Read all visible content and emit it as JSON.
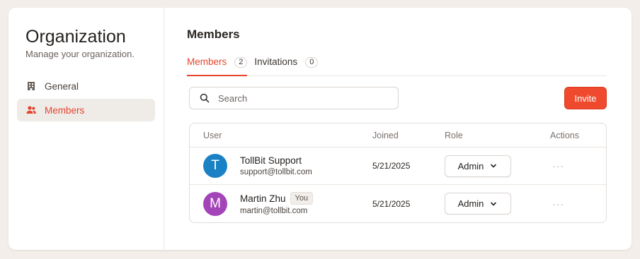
{
  "sidebar": {
    "title": "Organization",
    "subtitle": "Manage your organization.",
    "items": [
      {
        "label": "General",
        "icon": "building-icon",
        "active": false
      },
      {
        "label": "Members",
        "icon": "users-icon",
        "active": true
      }
    ]
  },
  "main": {
    "title": "Members",
    "tabs": [
      {
        "label": "Members",
        "count": "2",
        "active": true
      },
      {
        "label": "Invitations",
        "count": "0",
        "active": false
      }
    ],
    "search": {
      "placeholder": "Search"
    },
    "invite_label": "Invite",
    "table": {
      "headers": {
        "user": "User",
        "joined": "Joined",
        "role": "Role",
        "actions": "Actions"
      },
      "rows": [
        {
          "initial": "T",
          "name": "TollBit Support",
          "email": "support@tollbit.com",
          "you": "",
          "joined": "5/21/2025",
          "role": "Admin",
          "avatar_color": "#1a82c4"
        },
        {
          "initial": "M",
          "name": "Martin Zhu",
          "email": "martin@tollbit.com",
          "you": "You",
          "joined": "5/21/2025",
          "role": "Admin",
          "avatar_color": "#a344b8"
        }
      ]
    }
  },
  "colors": {
    "accent": "#ef4a2e",
    "background": "#f3eeea"
  }
}
